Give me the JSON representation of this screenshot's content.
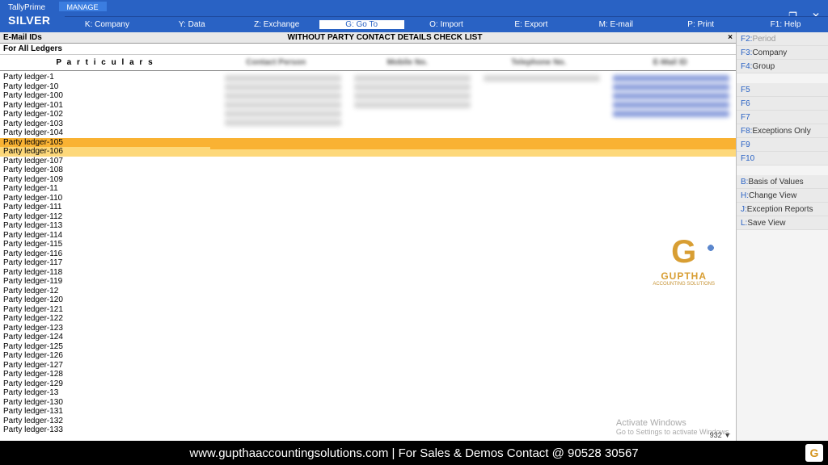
{
  "brand": {
    "name": "TallyPrime",
    "edition": "SILVER"
  },
  "manage": "MANAGE",
  "menu": {
    "company": "K: Company",
    "data": "Y: Data",
    "exchange": "Z: Exchange",
    "goto": "G: Go To",
    "import": "O: Import",
    "export": "E: Export",
    "email": "M: E-mail",
    "print": "P: Print",
    "help": "F1: Help"
  },
  "header": {
    "label": "E-Mail IDs",
    "title": "WITHOUT PARTY CONTACT DETAILS CHECK LIST",
    "close": "×"
  },
  "subheader": "For All Ledgers",
  "columns": {
    "particulars": "P a r t i c u l a r s",
    "contact": "Contact Person",
    "mobile": "Mobile No.",
    "telephone": "Telephone No.",
    "email": "E-Mail ID"
  },
  "ledgers": [
    "Party ledger-1",
    "Party ledger-10",
    "Party ledger-100",
    "Party ledger-101",
    "Party ledger-102",
    "Party ledger-103",
    "Party ledger-104",
    "Party ledger-105",
    "Party ledger-106",
    "Party ledger-107",
    "Party ledger-108",
    "Party ledger-109",
    "Party ledger-11",
    "Party ledger-110",
    "Party ledger-111",
    "Party ledger-112",
    "Party ledger-113",
    "Party ledger-114",
    "Party ledger-115",
    "Party ledger-116",
    "Party ledger-117",
    "Party ledger-118",
    "Party ledger-119",
    "Party ledger-12",
    "Party ledger-120",
    "Party ledger-121",
    "Party ledger-122",
    "Party ledger-123",
    "Party ledger-124",
    "Party ledger-125",
    "Party ledger-126",
    "Party ledger-127",
    "Party ledger-128",
    "Party ledger-129",
    "Party ledger-13",
    "Party ledger-130",
    "Party ledger-131",
    "Party ledger-132",
    "Party ledger-133"
  ],
  "highlight_index": 7,
  "side": [
    {
      "key": "F2:",
      "label": "Period",
      "disabled": true
    },
    {
      "key": "F3:",
      "label": "Company",
      "disabled": false
    },
    {
      "key": "F4:",
      "label": "Group",
      "disabled": false
    },
    {
      "spacer": true
    },
    {
      "key": "F5",
      "label": "",
      "disabled": true
    },
    {
      "key": "F6",
      "label": "",
      "disabled": true
    },
    {
      "key": "F7",
      "label": "",
      "disabled": true
    },
    {
      "key": "F8:",
      "label": "Exceptions Only",
      "disabled": false
    },
    {
      "key": "F9",
      "label": "",
      "disabled": true
    },
    {
      "key": "F10",
      "label": "",
      "disabled": true
    },
    {
      "spacer": true
    },
    {
      "key": "B:",
      "label": "Basis of Values",
      "disabled": false
    },
    {
      "key": "H:",
      "label": "Change View",
      "disabled": false
    },
    {
      "key": "J:",
      "label": "Exception Reports",
      "disabled": false
    },
    {
      "key": "L:",
      "label": "Save View",
      "disabled": false
    }
  ],
  "logo": {
    "name": "GUPTHA",
    "sub": "ACCOUNTING SOLUTIONS"
  },
  "activate": {
    "title": "Activate Windows",
    "sub": "Go to Settings to activate Windows."
  },
  "count": "932 ▼",
  "footer": "www.gupthaaccountingsolutions.com | For Sales & Demos Contact @ 90528 30567"
}
